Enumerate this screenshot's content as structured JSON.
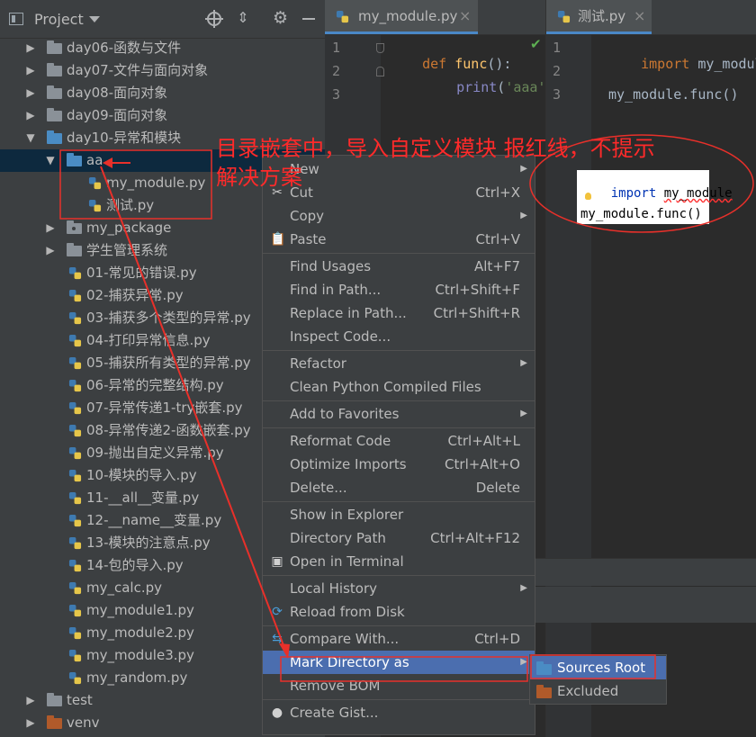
{
  "project_panel": {
    "title": "Project",
    "tree": [
      {
        "label": "day06-函数与文件",
        "type": "folder",
        "expanded": false,
        "depth": 0
      },
      {
        "label": "day07-文件与面向对象",
        "type": "folder",
        "expanded": false,
        "depth": 0
      },
      {
        "label": "day08-面向对象",
        "type": "folder",
        "expanded": false,
        "depth": 0
      },
      {
        "label": "day09-面向对象",
        "type": "folder",
        "expanded": false,
        "depth": 0
      },
      {
        "label": "day10-异常和模块",
        "type": "folder",
        "expanded": true,
        "depth": 0
      },
      {
        "label": "aa",
        "type": "folder",
        "expanded": true,
        "depth": 1,
        "selected": true
      },
      {
        "label": "my_module.py",
        "type": "py",
        "depth": 2
      },
      {
        "label": "测试.py",
        "type": "py",
        "depth": 2
      },
      {
        "label": "my_package",
        "type": "package",
        "expanded": false,
        "depth": 1
      },
      {
        "label": "学生管理系统",
        "type": "folder",
        "expanded": false,
        "depth": 1
      },
      {
        "label": "01-常见的错误.py",
        "type": "py",
        "depth": 1
      },
      {
        "label": "02-捕获异常.py",
        "type": "py",
        "depth": 1
      },
      {
        "label": "03-捕获多个类型的异常.py",
        "type": "py",
        "depth": 1
      },
      {
        "label": "04-打印异常信息.py",
        "type": "py",
        "depth": 1
      },
      {
        "label": "05-捕获所有类型的异常.py",
        "type": "py",
        "depth": 1
      },
      {
        "label": "06-异常的完整结构.py",
        "type": "py",
        "depth": 1
      },
      {
        "label": "07-异常传递1-try嵌套.py",
        "type": "py",
        "depth": 1
      },
      {
        "label": "08-异常传递2-函数嵌套.py",
        "type": "py",
        "depth": 1
      },
      {
        "label": "09-抛出自定义异常.py",
        "type": "py",
        "depth": 1
      },
      {
        "label": "10-模块的导入.py",
        "type": "py",
        "depth": 1
      },
      {
        "label": "11-__all__变量.py",
        "type": "py",
        "depth": 1
      },
      {
        "label": "12-__name__变量.py",
        "type": "py",
        "depth": 1
      },
      {
        "label": "13-模块的注意点.py",
        "type": "py",
        "depth": 1
      },
      {
        "label": "14-包的导入.py",
        "type": "py",
        "depth": 1
      },
      {
        "label": "my_calc.py",
        "type": "py",
        "depth": 1
      },
      {
        "label": "my_module1.py",
        "type": "py",
        "depth": 1
      },
      {
        "label": "my_module2.py",
        "type": "py",
        "depth": 1
      },
      {
        "label": "my_module3.py",
        "type": "py",
        "depth": 1
      },
      {
        "label": "my_random.py",
        "type": "py",
        "depth": 1
      },
      {
        "label": "test",
        "type": "folder",
        "expanded": false,
        "depth": 0
      },
      {
        "label": "venv",
        "type": "excluded",
        "expanded": false,
        "depth": 0
      }
    ]
  },
  "editor_left": {
    "tab": "my_module.py",
    "close": "×",
    "line_numbers": [
      "1",
      "2",
      "3"
    ],
    "line1": {
      "kw": "def",
      "name": "func",
      "rest": "():"
    },
    "line2": {
      "fn": "print",
      "open": "(",
      "str": "'aaa'",
      "close": ")"
    }
  },
  "editor_right": {
    "tab": "测试.py",
    "close": "×",
    "line_numbers": [
      "1",
      "2",
      "3"
    ],
    "line1": {
      "kw": "import",
      "rest": " my_module"
    },
    "line3": "my_module.func()"
  },
  "popup": {
    "line1_kw": "import",
    "line1_mod": "my_module",
    "line3": "my_module.func()"
  },
  "annotation": {
    "line1": "目录嵌套中，导入自定义模块 报红线，不提示",
    "line2": "解决方案"
  },
  "context_menu": {
    "items": [
      {
        "label": "New",
        "shortcut": "",
        "submenu": true
      },
      {
        "label": "Cut",
        "shortcut": "Ctrl+X",
        "icon": "scissors-icon"
      },
      {
        "label": "Copy",
        "shortcut": "",
        "submenu": true
      },
      {
        "label": "Paste",
        "shortcut": "Ctrl+V",
        "icon": "clipboard-icon"
      },
      {
        "separator": true
      },
      {
        "label": "Find Usages",
        "shortcut": "Alt+F7"
      },
      {
        "label": "Find in Path...",
        "shortcut": "Ctrl+Shift+F"
      },
      {
        "label": "Replace in Path...",
        "shortcut": "Ctrl+Shift+R"
      },
      {
        "label": "Inspect Code...",
        "shortcut": ""
      },
      {
        "separator": true
      },
      {
        "label": "Refactor",
        "shortcut": "",
        "submenu": true
      },
      {
        "label": "Clean Python Compiled Files",
        "shortcut": ""
      },
      {
        "separator": true
      },
      {
        "label": "Add to Favorites",
        "shortcut": "",
        "submenu": true
      },
      {
        "separator": true
      },
      {
        "label": "Reformat Code",
        "shortcut": "Ctrl+Alt+L"
      },
      {
        "label": "Optimize Imports",
        "shortcut": "Ctrl+Alt+O"
      },
      {
        "label": "Delete...",
        "shortcut": "Delete"
      },
      {
        "separator": true
      },
      {
        "label": "Show in Explorer",
        "shortcut": ""
      },
      {
        "label": "Directory Path",
        "shortcut": "Ctrl+Alt+F12"
      },
      {
        "label": "Open in Terminal",
        "shortcut": "",
        "icon": "terminal-icon"
      },
      {
        "separator": true
      },
      {
        "label": "Local History",
        "shortcut": "",
        "submenu": true
      },
      {
        "label": "Reload from Disk",
        "shortcut": "",
        "icon": "reload-icon"
      },
      {
        "separator": true
      },
      {
        "label": "Compare With...",
        "shortcut": "Ctrl+D",
        "icon": "compare-icon"
      },
      {
        "label": "Mark Directory as",
        "shortcut": "",
        "submenu": true,
        "active": true
      },
      {
        "label": "Remove BOM",
        "shortcut": ""
      },
      {
        "separator": true
      },
      {
        "label": "Create Gist...",
        "shortcut": "",
        "icon": "github-icon"
      }
    ]
  },
  "submenu": {
    "items": [
      {
        "label": "Sources Root",
        "icon": "folder-blue-icon",
        "active": true
      },
      {
        "label": "Excluded",
        "icon": "folder-orange-icon"
      }
    ]
  },
  "colors": {
    "accent": "#4b6eaf",
    "annotation_red": "#ff2a2a",
    "folder_blue": "#4a8cc4",
    "folder_orange": "#b05a2a",
    "panel_bg": "#3c3f41",
    "editor_bg": "#2b2b2b"
  }
}
